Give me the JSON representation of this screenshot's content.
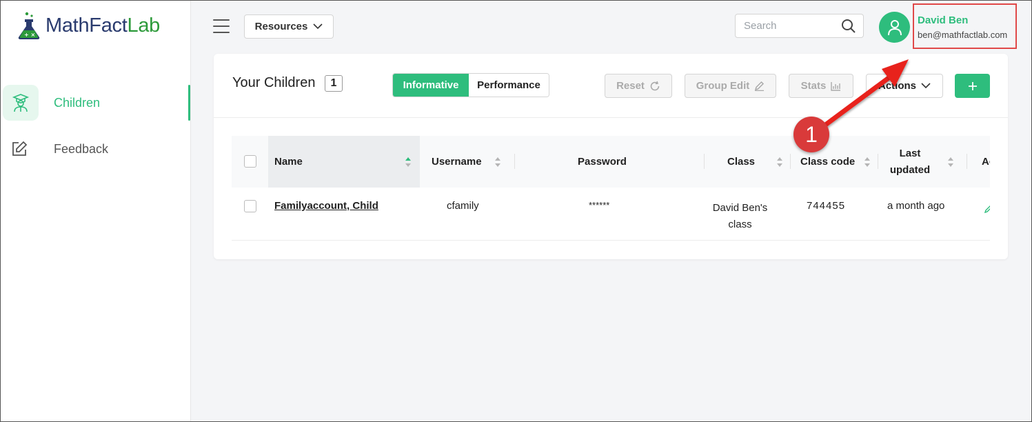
{
  "brand": {
    "part1": "Math",
    "part2": "Fact",
    "part3": "Lab",
    "accent": "#2ebd7d"
  },
  "sidebar": {
    "items": [
      {
        "label": "Children",
        "icon": "student-icon",
        "active": true
      },
      {
        "label": "Feedback",
        "icon": "edit-square-icon",
        "active": false
      }
    ]
  },
  "topbar": {
    "resources_label": "Resources",
    "search_placeholder": "Search",
    "user": {
      "name": "David Ben",
      "email": "ben@mathfactlab.com"
    }
  },
  "card": {
    "title": "Your Children",
    "count": "1",
    "view_tabs": [
      "Informative",
      "Performance"
    ],
    "active_tab": "Informative",
    "buttons": {
      "reset": "Reset",
      "group_edit": "Group Edit",
      "stats": "Stats",
      "actions": "Actions",
      "add": "+"
    }
  },
  "table": {
    "columns": [
      "Name",
      "Username",
      "Password",
      "Class",
      "Class code",
      "Last updated",
      "Ac"
    ],
    "last_updated_line1": "Last",
    "last_updated_line2": "updated",
    "rows": [
      {
        "name": "Familyaccount, Child",
        "username": "cfamily",
        "password": "******",
        "class_line1": "David Ben's",
        "class_line2": "class",
        "class_code": "744455",
        "last_updated": "a month ago"
      }
    ]
  },
  "annotation": {
    "step": "1",
    "color": "#d93a3a"
  }
}
